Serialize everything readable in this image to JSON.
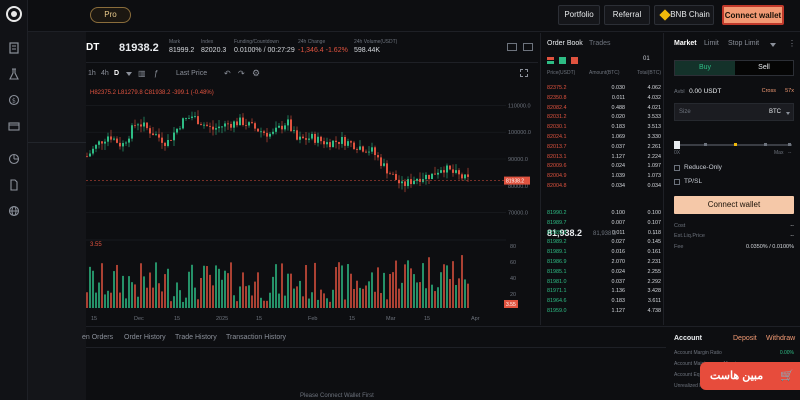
{
  "topbar": {
    "pro_label": "Pro",
    "portfolio_label": "Portfolio",
    "referral_label": "Referral",
    "chain_label": "BNB Chain",
    "connect_label": "Connect wallet"
  },
  "chart_header": {
    "pair_fragment": "DT",
    "price": "81938.2",
    "mark_label": "Mark",
    "mark_value": "81999.2",
    "index_label": "Index",
    "index_value": "82020.3",
    "funding_label": "Funding/Countdown",
    "funding_value": "0.0100% / 00:27:29",
    "change_label": "24h Change",
    "change_value": "-1,346.4 -1.62%",
    "volume_label": "24h Volume(USDT)",
    "volume_value": "598.44K"
  },
  "chart_tools": {
    "timeframes": [
      "1h",
      "4h",
      "D"
    ],
    "active_timeframe": "D",
    "last_price_label": "Last Price"
  },
  "chart": {
    "ohlc_text": "H82375.2  L81279.8  C81938.2  -399.1 (-0.48%)",
    "volume_text": "3.55",
    "price_ticks": [
      "110000.0",
      "100000.0",
      "90000.0",
      "80000.0",
      "70000.0"
    ],
    "last_price_tag": "81938.2",
    "volume_ticks": [
      "80",
      "60",
      "40",
      "20"
    ],
    "volume_tag": "3.55",
    "x_labels": [
      "15",
      "Dec",
      "15",
      "2025",
      "15",
      "Feb",
      "15",
      "Mar",
      "15",
      "Apr"
    ]
  },
  "orderbook": {
    "tab_book": "Order Book",
    "tab_trades": "Trades",
    "precision": "01",
    "col_price": "Price(USDT)",
    "col_amount": "Amount(BTC)",
    "col_total": "Total(BTC)",
    "asks": [
      [
        "82375.2",
        "0.030",
        "4.062"
      ],
      [
        "82350.8",
        "0.011",
        "4.032"
      ],
      [
        "82082.4",
        "0.488",
        "4.021"
      ],
      [
        "82031.2",
        "0.020",
        "3.533"
      ],
      [
        "82030.1",
        "0.183",
        "3.513"
      ],
      [
        "82024.1",
        "1.069",
        "3.330"
      ],
      [
        "82013.7",
        "0.037",
        "2.261"
      ],
      [
        "82013.1",
        "1.127",
        "2.224"
      ],
      [
        "82009.6",
        "0.024",
        "1.097"
      ],
      [
        "82004.9",
        "1.039",
        "1.073"
      ],
      [
        "82004.8",
        "0.034",
        "0.034"
      ]
    ],
    "mid_price": "81,938.2",
    "mid_sub": "81,938.2",
    "bids": [
      [
        "81990.2",
        "0.100",
        "0.100"
      ],
      [
        "81989.7",
        "0.007",
        "0.107"
      ],
      [
        "81989.3",
        "0.011",
        "0.118"
      ],
      [
        "81989.2",
        "0.027",
        "0.145"
      ],
      [
        "81989.1",
        "0.016",
        "0.161"
      ],
      [
        "81986.9",
        "2.070",
        "2.231"
      ],
      [
        "81985.1",
        "0.024",
        "2.255"
      ],
      [
        "81981.0",
        "0.037",
        "2.292"
      ],
      [
        "81971.1",
        "1.136",
        "3.428"
      ],
      [
        "81964.6",
        "0.183",
        "3.611"
      ],
      [
        "81959.0",
        "1.127",
        "4.738"
      ]
    ]
  },
  "trade": {
    "tab_market": "Market",
    "tab_limit": "Limit",
    "tab_stop": "Stop Limit",
    "buy_label": "Buy",
    "sell_label": "Sell",
    "avbl_label": "Avbl",
    "avbl_value": "0.00 USDT",
    "cross_label": "Cross",
    "leverage": "57x",
    "size_label": "Size",
    "size_unit": "BTC",
    "slider_min": "0X",
    "slider_max": "Max",
    "slider_max_value": "--",
    "reduce_only": "Reduce-Only",
    "tp_sl": "TP/SL",
    "connect_label": "Connect wallet",
    "cost_label": "Cost",
    "cost_value": "--",
    "liq_label": "Est.Liq.Price",
    "liq_value": "--",
    "fee_label": "Fee",
    "fee_value": "0.0350% / 0.0100%"
  },
  "bottom_tabs": {
    "tabs": [
      "en Orders",
      "Order History",
      "Trade History",
      "Transaction History"
    ],
    "empty_text": "Please Connect Wallet First"
  },
  "account": {
    "title": "Account",
    "deposit": "Deposit",
    "withdraw": "Withdraw",
    "margin_ratio_label": "Account Margin Ratio",
    "margin_ratio_value": "0.00%",
    "maintenance_label": "Account Maintenance Margin",
    "equity_label": "Account Equity",
    "unrealized_label": "Unrealized PNL"
  },
  "watermark": {
    "text": "مبین هاست"
  },
  "colors": {
    "up": "#2ebd85",
    "down": "#e0533f",
    "accent": "#f29a74"
  }
}
